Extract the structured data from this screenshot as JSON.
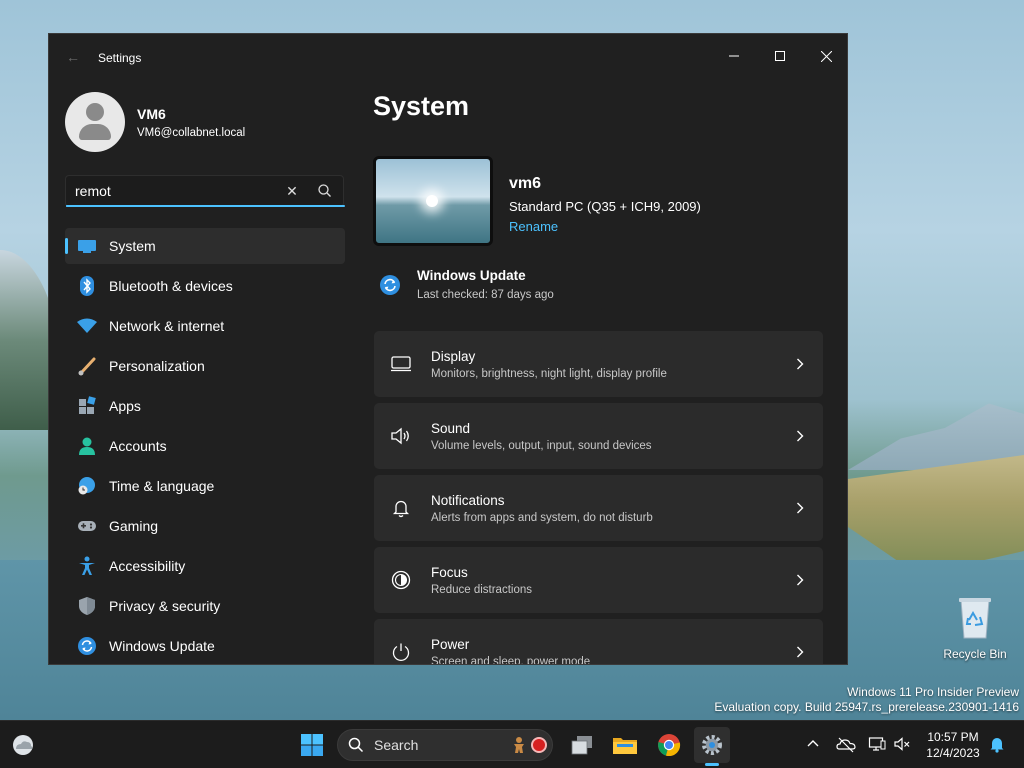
{
  "window": {
    "title": "Settings",
    "back_icon": "back-arrow-icon",
    "minimize_icon": "minimize-icon",
    "maximize_icon": "maximize-icon",
    "close_icon": "close-icon"
  },
  "user": {
    "name": "VM6",
    "email": "VM6@collabnet.local"
  },
  "search": {
    "value": "remot",
    "clear_icon": "clear-icon",
    "search_icon": "search-icon"
  },
  "nav": {
    "items": [
      {
        "label": "System",
        "icon": "monitor-icon",
        "active": true
      },
      {
        "label": "Bluetooth & devices",
        "icon": "bluetooth-icon"
      },
      {
        "label": "Network & internet",
        "icon": "wifi-icon"
      },
      {
        "label": "Personalization",
        "icon": "brush-icon"
      },
      {
        "label": "Apps",
        "icon": "apps-icon"
      },
      {
        "label": "Accounts",
        "icon": "person-icon"
      },
      {
        "label": "Time & language",
        "icon": "globe-clock-icon"
      },
      {
        "label": "Gaming",
        "icon": "gamepad-icon"
      },
      {
        "label": "Accessibility",
        "icon": "accessibility-icon"
      },
      {
        "label": "Privacy & security",
        "icon": "shield-icon"
      },
      {
        "label": "Windows Update",
        "icon": "update-icon"
      }
    ]
  },
  "main": {
    "title": "System",
    "device": {
      "name": "vm6",
      "model": "Standard PC (Q35 + ICH9, 2009)",
      "rename": "Rename"
    },
    "windows_update": {
      "title": "Windows Update",
      "subtitle": "Last checked: 87 days ago"
    },
    "cards": [
      {
        "title": "Display",
        "subtitle": "Monitors, brightness, night light, display profile",
        "icon": "display-icon"
      },
      {
        "title": "Sound",
        "subtitle": "Volume levels, output, input, sound devices",
        "icon": "speaker-icon"
      },
      {
        "title": "Notifications",
        "subtitle": "Alerts from apps and system, do not disturb",
        "icon": "bell-icon"
      },
      {
        "title": "Focus",
        "subtitle": "Reduce distractions",
        "icon": "focus-icon"
      },
      {
        "title": "Power",
        "subtitle": "Screen and sleep, power mode",
        "icon": "power-icon"
      }
    ]
  },
  "desktop": {
    "recycle_bin": "Recycle Bin",
    "watermark_line1": "Windows 11 Pro Insider Preview",
    "watermark_line2": "Evaluation copy. Build 25947.rs_prerelease.230901-1416"
  },
  "taskbar": {
    "search_label": "Search",
    "time": "10:57 PM",
    "date": "12/4/2023"
  },
  "colors": {
    "accent": "#4cc2ff",
    "window_bg": "#202020",
    "card_bg": "#2b2b2b"
  }
}
